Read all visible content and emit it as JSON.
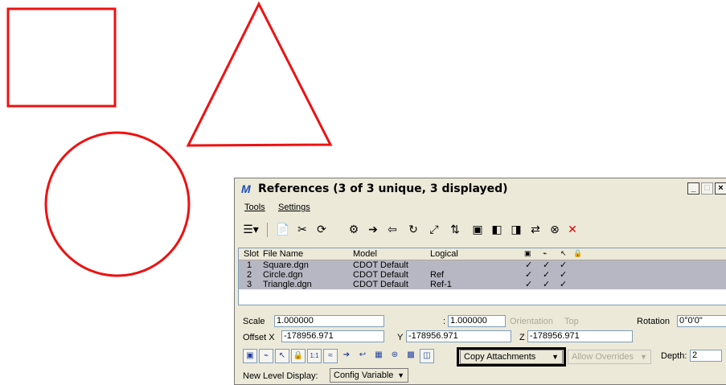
{
  "colors": {
    "shape_stroke": "#ee1111",
    "row_selected": "#b7b7c4",
    "dialog_bg": "#ece9d8"
  },
  "canvas": {
    "shapes": [
      "square",
      "triangle",
      "circle"
    ]
  },
  "window": {
    "title": "References (3 of 3 unique, 3 displayed)",
    "icon": "microstation-icon",
    "controls": [
      "minimize",
      "maximize",
      "close"
    ]
  },
  "menu": {
    "tools": "Tools",
    "settings": "Settings"
  },
  "toolbar_icons": [
    "list-view-icon",
    "attach-reference-icon",
    "detach-reference-icon",
    "reload-icon",
    "clip-boundary-icon",
    "move-icon",
    "copy-icon",
    "rotate-icon",
    "scale-icon",
    "mirror-icon",
    "clip-mask-icon",
    "clip-front-icon",
    "clip-back-icon",
    "exchange-icon",
    "delete-clip-icon"
  ],
  "table": {
    "columns": [
      "Slot",
      "File Name",
      "Model",
      "Logical"
    ],
    "icon_columns": [
      "display-icon",
      "snap-icon",
      "locate-icon",
      "lock-icon"
    ],
    "rows": [
      {
        "slot": "1",
        "file": "Square.dgn",
        "model": "CDOT Default",
        "logical": "",
        "checks": [
          "✓",
          "✓",
          "✓"
        ]
      },
      {
        "slot": "2",
        "file": "Circle.dgn",
        "model": "CDOT Default",
        "logical": "Ref",
        "checks": [
          "✓",
          "✓",
          "✓"
        ]
      },
      {
        "slot": "3",
        "file": "Triangle.dgn",
        "model": "CDOT Default",
        "logical": "Ref-1",
        "checks": [
          "✓",
          "✓",
          "✓"
        ]
      }
    ]
  },
  "fields": {
    "scale_label": "Scale",
    "scale_value": "1.000000",
    "ratio_sep": ":",
    "ratio_value": "1.000000",
    "orientation_label": "Orientation",
    "orientation_value": "Top",
    "rotation_label": "Rotation",
    "rotation_value": "0°0'0\"",
    "offset_label": "Offset X",
    "offset_x": "-178956.971",
    "y_label": "Y",
    "offset_y": "-178956.971",
    "z_label": "Z",
    "offset_z": "-178956.971"
  },
  "controls": {
    "copy_attachments": "Copy Attachments",
    "allow_overrides": "Allow Overrides",
    "depth_label": "Depth:",
    "depth_value": "2",
    "new_level_label": "New Level Display:",
    "new_level_value": "Config Variable"
  }
}
